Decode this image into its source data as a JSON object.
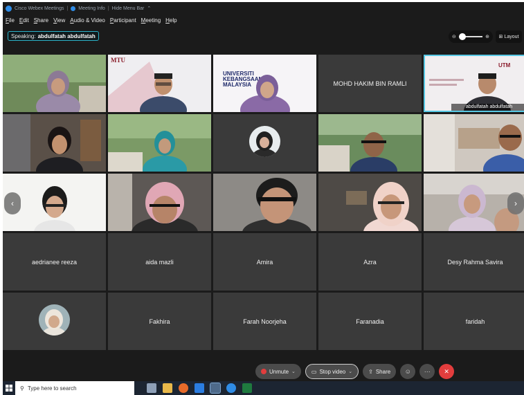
{
  "titlebar": {
    "app": "Cisco Webex Meetings",
    "info": "Meeting Info",
    "hide": "Hide Menu Bar"
  },
  "menu": [
    "File",
    "Edit",
    "Share",
    "View",
    "Audio & Video",
    "Participant",
    "Meeting",
    "Help"
  ],
  "speaking": {
    "label": "Speaking:",
    "name": "abdulfatah abdulfatah"
  },
  "layout_label": "Layout",
  "participants_named": [
    "MOHD HAKIM BIN RAMLI",
    "abdulfatah abdulfatah",
    "aedrianee reeza",
    "aida mazli",
    "Amira",
    "Azra",
    "Desy Rahma Savira",
    "Fakhira",
    "Farah Noorjeha",
    "Faranadia",
    "faridah"
  ],
  "slide_texts": {
    "mtu": "MTU",
    "ukm_line1": "UNIVERSITI",
    "ukm_line2": "KEBANGSAAN",
    "ukm_line3": "MALAYSIA",
    "utm": "UTM"
  },
  "controls": {
    "unmute": "Unmute",
    "stop_video": "Stop video",
    "share": "Share"
  },
  "taskbar": {
    "search_placeholder": "Type here to search"
  }
}
